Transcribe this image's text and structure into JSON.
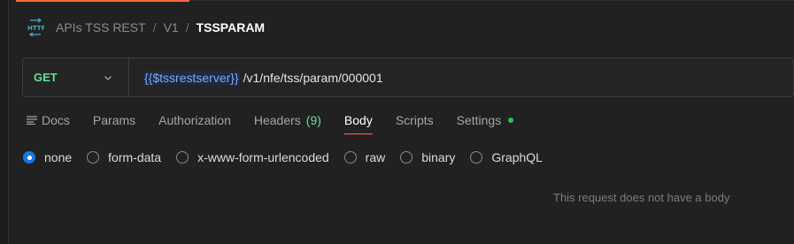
{
  "breadcrumb": {
    "icon": "http-icon",
    "items": [
      "APIs TSS REST",
      "V1"
    ],
    "separator": "/",
    "current": "TSSPARAM"
  },
  "request": {
    "method": "GET",
    "url_variable": "{{$tssrestserver}}",
    "url_path": "/v1/nfe/tss/param/000001"
  },
  "tabs": {
    "docs": "Docs",
    "params": "Params",
    "authorization": "Authorization",
    "headers": "Headers",
    "headers_count": "(9)",
    "body": "Body",
    "scripts": "Scripts",
    "settings": "Settings",
    "active": "Body"
  },
  "body_types": {
    "selected": "none",
    "options": [
      "none",
      "form-data",
      "x-www-form-urlencoded",
      "raw",
      "binary",
      "GraphQL"
    ]
  },
  "message": "This request does not have a body",
  "colors": {
    "method_get": "#6bdd9a",
    "accent": "#ff6c37",
    "variable": "#78a8ff",
    "radio_selected": "#1b73e8",
    "settings_dot": "#2fbf5b"
  }
}
